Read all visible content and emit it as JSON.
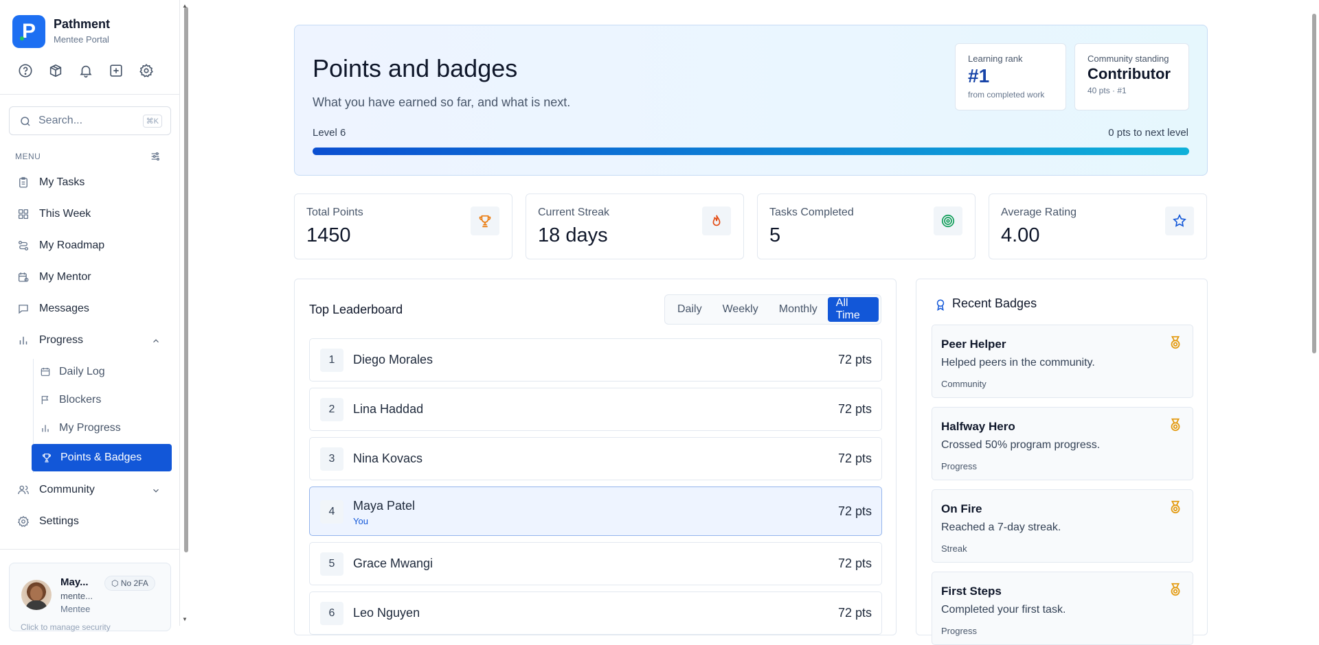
{
  "app": {
    "name": "Pathment",
    "subtitle": "Mentee Portal",
    "logo_letter": "P",
    "accent": "#1257d8"
  },
  "topbar_icons": [
    "help-icon",
    "package-icon",
    "bell-icon",
    "new-item-icon",
    "gear-icon"
  ],
  "search": {
    "placeholder": "Search...",
    "shortcut": "⌘K"
  },
  "menu": {
    "label": "MENU",
    "items": [
      {
        "label": "My Tasks",
        "icon": "clipboard-icon"
      },
      {
        "label": "This Week",
        "icon": "grid-icon"
      },
      {
        "label": "My Roadmap",
        "icon": "route-icon"
      },
      {
        "label": "My Mentor",
        "icon": "calendar-user-icon"
      },
      {
        "label": "Messages",
        "icon": "chat-icon"
      },
      {
        "label": "Progress",
        "icon": "bar-chart-icon"
      }
    ],
    "progress_sub": [
      {
        "label": "Daily Log",
        "icon": "calendar-icon"
      },
      {
        "label": "Blockers",
        "icon": "flag-icon"
      },
      {
        "label": "My Progress",
        "icon": "bar-chart-icon"
      },
      {
        "label": "Points & Badges",
        "icon": "trophy-icon"
      }
    ],
    "community": "Community",
    "settings": "Settings"
  },
  "user": {
    "name": "May...",
    "email": "mente...",
    "role": "Mentee",
    "twofa": "No 2FA",
    "hint": "Click to manage security"
  },
  "hero": {
    "title": "Points and badges",
    "subtitle": "What you have earned so far, and what is next.",
    "level": "Level 6",
    "next_level": "0 pts to next level",
    "progress_pct": 100,
    "rank_label": "Learning rank",
    "rank_value": "#1",
    "rank_sub": "from completed work",
    "standing_label": "Community standing",
    "standing_value": "Contributor",
    "standing_sub": "40 pts · #1"
  },
  "stats": [
    {
      "label": "Total Points",
      "value": "1450",
      "icon": "trophy-icon",
      "color": "#ea7a0c"
    },
    {
      "label": "Current Streak",
      "value": "18 days",
      "icon": "flame-icon",
      "color": "#e3480f"
    },
    {
      "label": "Tasks Completed",
      "value": "5",
      "icon": "target-icon",
      "color": "#0f9d58"
    },
    {
      "label": "Average Rating",
      "value": "4.00",
      "icon": "star-icon",
      "color": "#1257d8"
    }
  ],
  "leaderboard": {
    "title": "Top Leaderboard",
    "tabs": [
      "Daily",
      "Weekly",
      "Monthly",
      "All Time"
    ],
    "active_tab": "All Time",
    "rows": [
      {
        "rank": "1",
        "name": "Diego Morales",
        "points": "72 pts"
      },
      {
        "rank": "2",
        "name": "Lina Haddad",
        "points": "72 pts"
      },
      {
        "rank": "3",
        "name": "Nina Kovacs",
        "points": "72 pts"
      },
      {
        "rank": "4",
        "name": "Maya Patel",
        "points": "72 pts",
        "you": "You"
      },
      {
        "rank": "5",
        "name": "Grace Mwangi",
        "points": "72 pts"
      },
      {
        "rank": "6",
        "name": "Leo Nguyen",
        "points": "72 pts"
      }
    ]
  },
  "badges": {
    "title": "Recent Badges",
    "items": [
      {
        "title": "Peer Helper",
        "desc": "Helped peers in the community.",
        "category": "Community"
      },
      {
        "title": "Halfway Hero",
        "desc": "Crossed 50% program progress.",
        "category": "Progress"
      },
      {
        "title": "On Fire",
        "desc": "Reached a 7-day streak.",
        "category": "Streak"
      },
      {
        "title": "First Steps",
        "desc": "Completed your first task.",
        "category": "Progress"
      }
    ]
  }
}
